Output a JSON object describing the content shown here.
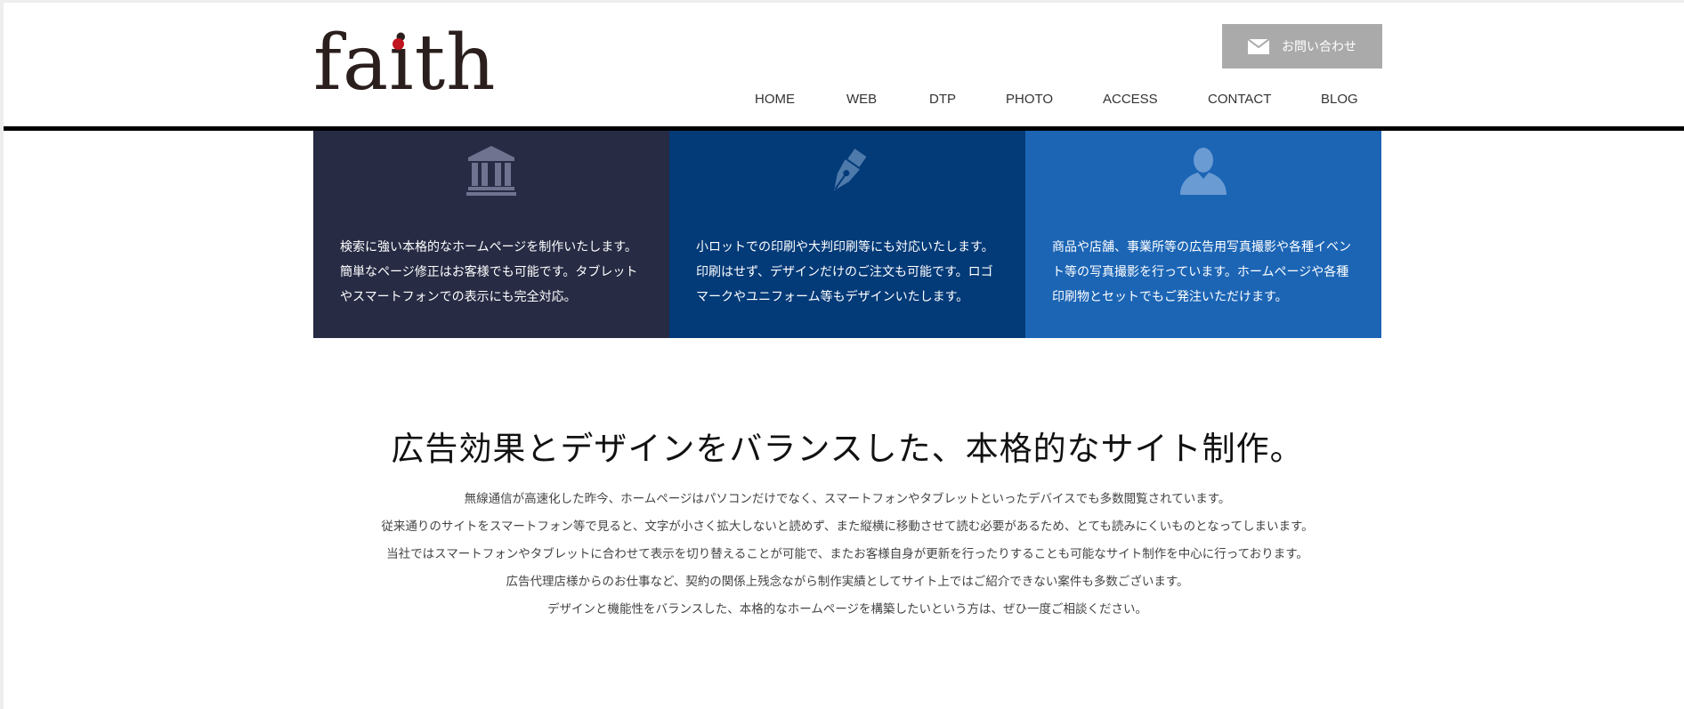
{
  "header": {
    "logo_text": "faith",
    "contact_label": "お問い合わせ",
    "nav": [
      "HOME",
      "WEB",
      "DTP",
      "PHOTO",
      "ACCESS",
      "CONTACT",
      "BLOG"
    ]
  },
  "services": [
    {
      "icon": "bank-icon",
      "lines": [
        "検索に強い本格的なホームページを制作いたします。",
        "簡単なページ修正はお客様でも可能です。タブレット",
        "やスマートフォンでの表示にも完全対応。"
      ]
    },
    {
      "icon": "pen-nib-icon",
      "lines": [
        "小ロットでの印刷や大判印刷等にも対応いたします。",
        "印刷はせず、デザインだけのご注文も可能です。ロゴ",
        "マークやユニフォーム等もデザインいたします。"
      ]
    },
    {
      "icon": "user-icon",
      "lines": [
        "商品や店舗、事業所等の広告用写真撮影や各種イベン",
        "ト等の写真撮影を行っています。ホームページや各種",
        "印刷物とセットでもご発注いただけます。"
      ]
    }
  ],
  "intro": {
    "heading": "広告効果とデザインをバランスした、本格的なサイト制作。",
    "lines": [
      "無線通信が高速化した昨今、ホームページはパソコンだけでなく、スマートフォンやタブレットといったデバイスでも多数閲覧されています。",
      "従来通りのサイトをスマートフォン等で見ると、文字が小さく拡大しないと読めず、また縦横に移動させて読む必要があるため、とても読みにくいものとなってしまいます。",
      "当社ではスマートフォンやタブレットに合わせて表示を切り替えることが可能で、またお客様自身が更新を行ったりすることも可能なサイト制作を中心に行っております。",
      "広告代理店様からのお仕事など、契約の関係上残念ながら制作実績としてサイト上ではご紹介できない案件も多数ございます。",
      "デザインと機能性をバランスした、本格的なホームページを構築したいという方は、ぜひ一度ご相談ください。"
    ]
  },
  "colors": {
    "web_panel": "#272b44",
    "dtp_panel": "#033a78",
    "photo_panel": "#1c65b5",
    "contact_button": "#aaaaaa",
    "logo_dot": "#c0141e"
  }
}
